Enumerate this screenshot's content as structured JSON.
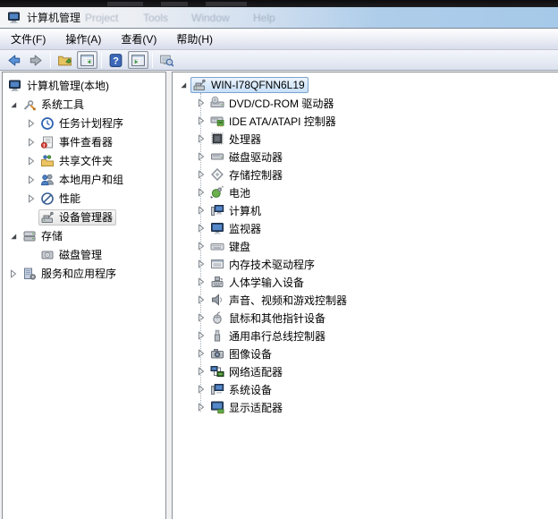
{
  "window": {
    "title": "计算机管理"
  },
  "background_app": {
    "ghost_menu": [
      "Project",
      "Tools",
      "Window",
      "Help"
    ]
  },
  "menubar": {
    "items": [
      {
        "id": "file",
        "label": "文件(F)"
      },
      {
        "id": "action",
        "label": "操作(A)"
      },
      {
        "id": "view",
        "label": "查看(V)"
      },
      {
        "id": "help",
        "label": "帮助(H)"
      }
    ]
  },
  "toolbar": {
    "buttons": [
      {
        "type": "button",
        "id": "back",
        "icon": "back-arrow-icon"
      },
      {
        "type": "button",
        "id": "forward",
        "icon": "forward-arrow-icon"
      },
      {
        "type": "separator"
      },
      {
        "type": "button",
        "id": "up-folder",
        "icon": "folder-up-icon"
      },
      {
        "type": "button",
        "id": "console-tree-toggle",
        "icon": "console-tree-icon",
        "pressed": true
      },
      {
        "type": "separator"
      },
      {
        "type": "button",
        "id": "help",
        "icon": "help-icon"
      },
      {
        "type": "button",
        "id": "action-pane-toggle",
        "icon": "action-pane-icon",
        "pressed": true
      },
      {
        "type": "separator"
      },
      {
        "type": "button",
        "id": "scan-hardware",
        "icon": "scan-hardware-icon"
      }
    ]
  },
  "left_tree": {
    "items": [
      {
        "id": "computer-management-local",
        "label": "计算机管理(本地)",
        "level": 0,
        "expand": "none",
        "icon": "computer-mgmt-icon"
      },
      {
        "id": "system-tools",
        "label": "系统工具",
        "level": 1,
        "expand": "expanded",
        "icon": "system-tools-icon"
      },
      {
        "id": "task-scheduler",
        "label": "任务计划程序",
        "level": 2,
        "expand": "collapsed",
        "icon": "task-scheduler-icon"
      },
      {
        "id": "event-viewer",
        "label": "事件查看器",
        "level": 2,
        "expand": "collapsed",
        "icon": "event-viewer-icon"
      },
      {
        "id": "shared-folders",
        "label": "共享文件夹",
        "level": 2,
        "expand": "collapsed",
        "icon": "shared-folder-icon"
      },
      {
        "id": "local-users-groups",
        "label": "本地用户和组",
        "level": 2,
        "expand": "collapsed",
        "icon": "local-users-icon"
      },
      {
        "id": "performance",
        "label": "性能",
        "level": 2,
        "expand": "collapsed",
        "icon": "performance-icon"
      },
      {
        "id": "device-manager",
        "label": "设备管理器",
        "level": 2,
        "expand": "none",
        "icon": "device-manager-icon",
        "selected": "unfocused"
      },
      {
        "id": "storage",
        "label": "存储",
        "level": 1,
        "expand": "expanded",
        "icon": "storage-icon"
      },
      {
        "id": "disk-management",
        "label": "磁盘管理",
        "level": 2,
        "expand": "none",
        "icon": "disk-mgmt-icon"
      },
      {
        "id": "services-apps",
        "label": "服务和应用程序",
        "level": 1,
        "expand": "collapsed",
        "icon": "services-apps-icon"
      }
    ]
  },
  "right_tree": {
    "items": [
      {
        "id": "computer-root",
        "label": "WIN-I78QFNN6L19",
        "level": 0,
        "expand": "expanded",
        "icon": "device-manager-icon",
        "selected": "focused"
      },
      {
        "id": "dvd-cdrom",
        "label": "DVD/CD-ROM 驱动器",
        "level": 1,
        "expand": "collapsed",
        "icon": "dvd-drive-icon"
      },
      {
        "id": "ide-ata-atapi",
        "label": "IDE ATA/ATAPI 控制器",
        "level": 1,
        "expand": "collapsed",
        "icon": "ide-controller-icon"
      },
      {
        "id": "processors",
        "label": "处理器",
        "level": 1,
        "expand": "collapsed",
        "icon": "processor-icon"
      },
      {
        "id": "disk-drives",
        "label": "磁盘驱动器",
        "level": 1,
        "expand": "collapsed",
        "icon": "disk-drive-icon"
      },
      {
        "id": "storage-controllers",
        "label": "存储控制器",
        "level": 1,
        "expand": "collapsed",
        "icon": "storage-controller-icon"
      },
      {
        "id": "batteries",
        "label": "电池",
        "level": 1,
        "expand": "collapsed",
        "icon": "battery-icon"
      },
      {
        "id": "computer",
        "label": "计算机",
        "level": 1,
        "expand": "collapsed",
        "icon": "computer-device-icon"
      },
      {
        "id": "monitors",
        "label": "监视器",
        "level": 1,
        "expand": "collapsed",
        "icon": "monitor-icon"
      },
      {
        "id": "keyboards",
        "label": "键盘",
        "level": 1,
        "expand": "collapsed",
        "icon": "keyboard-icon"
      },
      {
        "id": "memory-tech",
        "label": "内存技术驱动程序",
        "level": 1,
        "expand": "collapsed",
        "icon": "memory-tech-icon"
      },
      {
        "id": "hid-devices",
        "label": "人体学输入设备",
        "level": 1,
        "expand": "collapsed",
        "icon": "hid-icon"
      },
      {
        "id": "sound-video-game",
        "label": "声音、视频和游戏控制器",
        "level": 1,
        "expand": "collapsed",
        "icon": "sound-icon"
      },
      {
        "id": "mice-pointing",
        "label": "鼠标和其他指针设备",
        "level": 1,
        "expand": "collapsed",
        "icon": "mouse-icon"
      },
      {
        "id": "usb-controllers",
        "label": "通用串行总线控制器",
        "level": 1,
        "expand": "collapsed",
        "icon": "usb-icon"
      },
      {
        "id": "imaging-devices",
        "label": "图像设备",
        "level": 1,
        "expand": "collapsed",
        "icon": "imaging-icon"
      },
      {
        "id": "network-adapters",
        "label": "网络适配器",
        "level": 1,
        "expand": "collapsed",
        "icon": "network-icon"
      },
      {
        "id": "system-devices",
        "label": "系统设备",
        "level": 1,
        "expand": "collapsed",
        "icon": "system-devices-icon"
      },
      {
        "id": "display-adapters",
        "label": "显示适配器",
        "level": 1,
        "expand": "collapsed",
        "icon": "display-adapter-icon"
      }
    ]
  },
  "colors": {
    "selection_focused_border": "#7da2ce",
    "selection_focused_bg": "#c8e0f9",
    "selection_unfocused_bg": "#e6e6e6",
    "titlebar_blue": "#a6c9e9",
    "pane_border": "#8a9097"
  }
}
